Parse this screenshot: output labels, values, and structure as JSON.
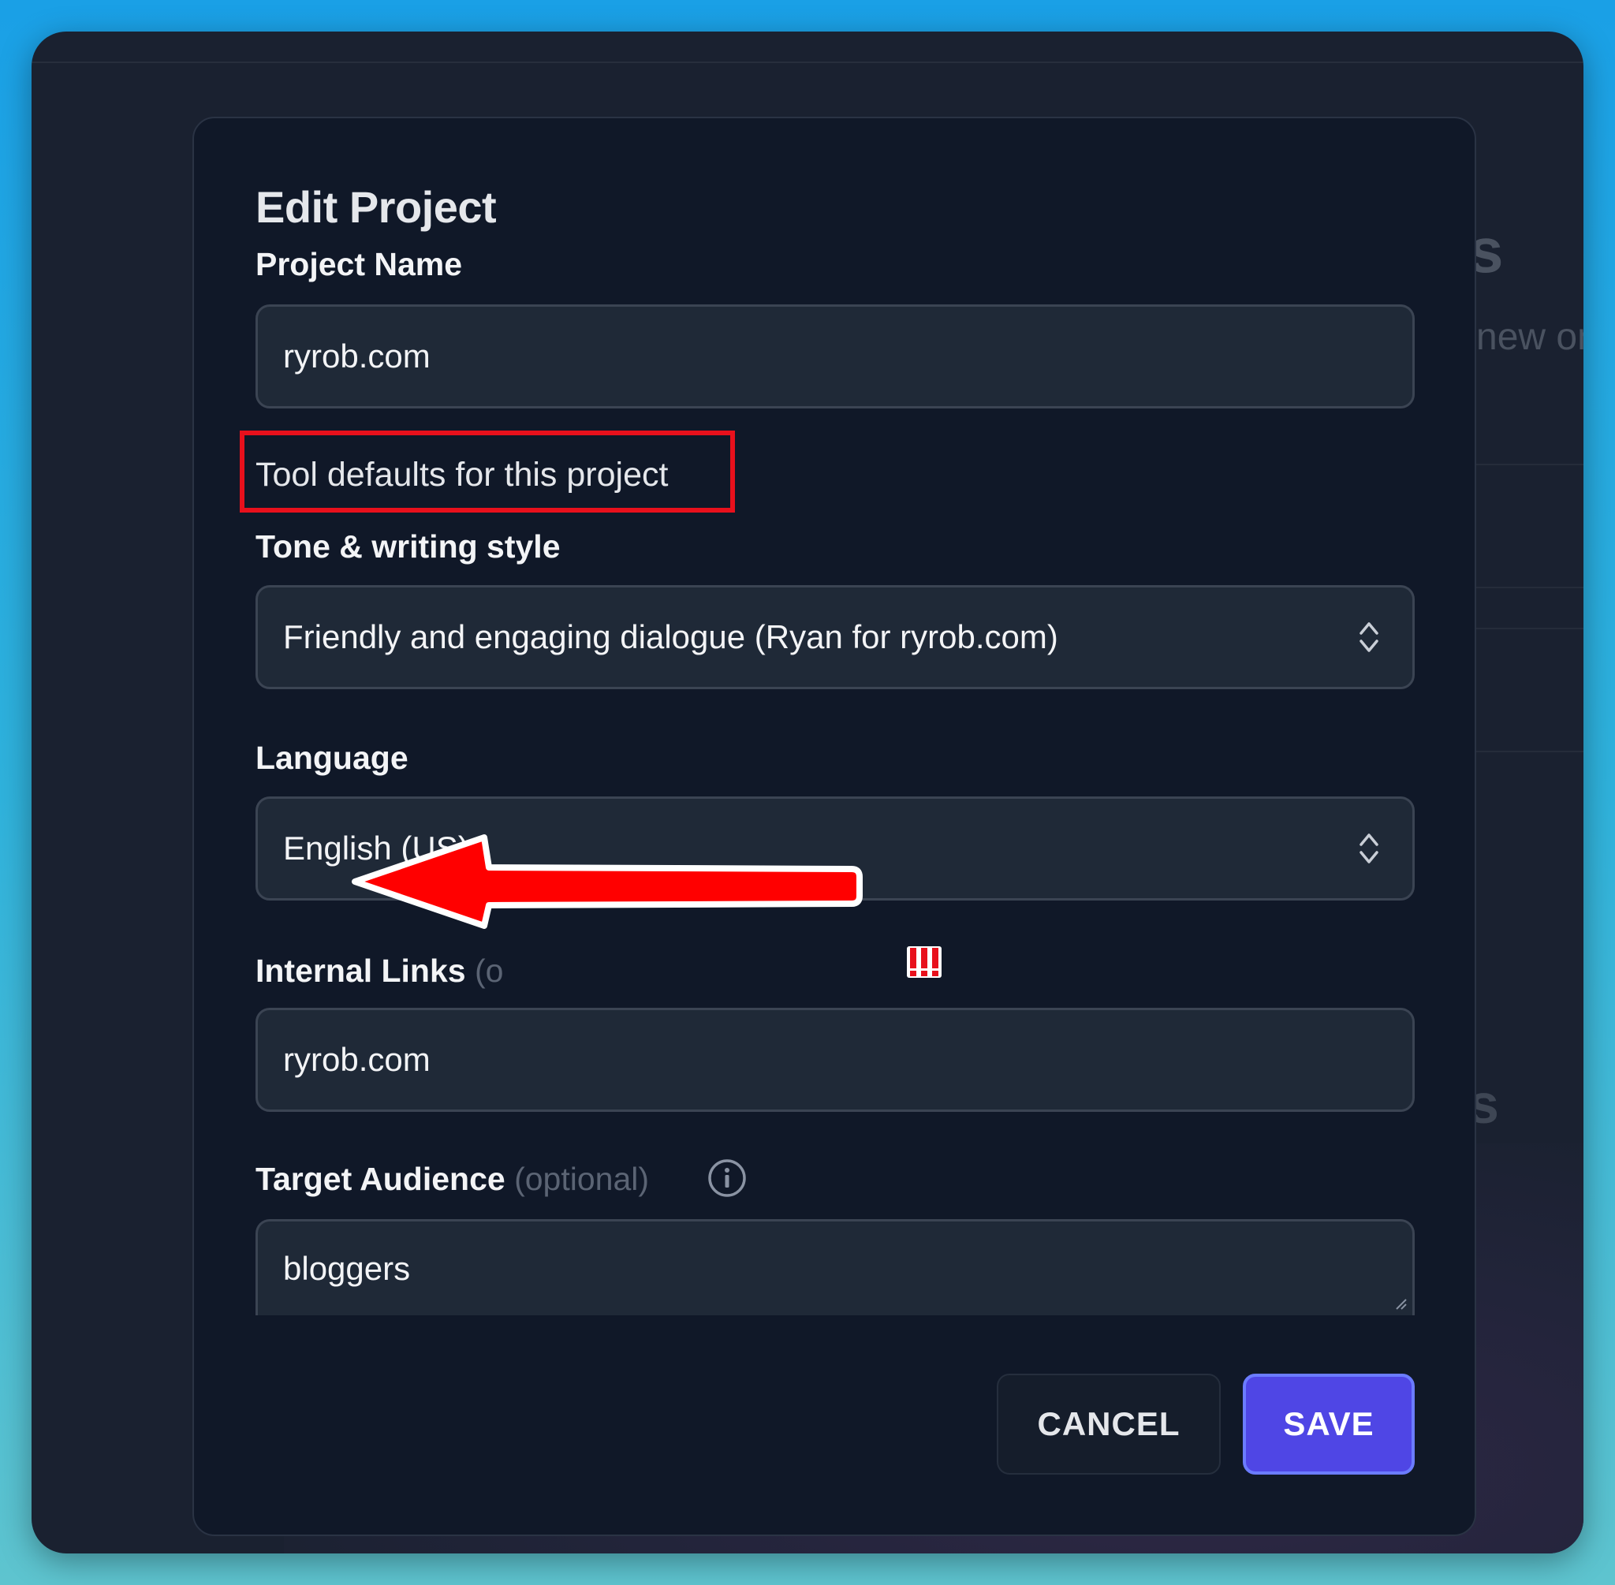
{
  "modal": {
    "title": "Edit Project",
    "project_name_label": "Project Name",
    "project_name_value": "ryrob.com",
    "section_heading": "Tool defaults for this project",
    "tone_label": "Tone & writing style",
    "tone_value": "Friendly and engaging dialogue (Ryan for ryrob.com)",
    "language_label": "Language",
    "language_value": "English (US)",
    "internal_links_label": "Internal Links",
    "internal_links_optional_fragment": "(o",
    "internal_links_value": "ryrob.com",
    "target_audience_label": "Target Audience",
    "target_audience_optional": "(optional)",
    "target_audience_value": "bloggers",
    "cancel_label": "CANCEL",
    "save_label": "SAVE"
  },
  "background": {
    "heading_fragment": "s",
    "subtext_fragment": "new on",
    "heading_fragment_2": "s"
  },
  "annotations": {
    "highlight_color": "#e8101c",
    "arrow_color": "#ff0000"
  },
  "colors": {
    "modal_bg": "#101828",
    "field_bg": "#1f2937",
    "accent": "#4f46e5"
  }
}
